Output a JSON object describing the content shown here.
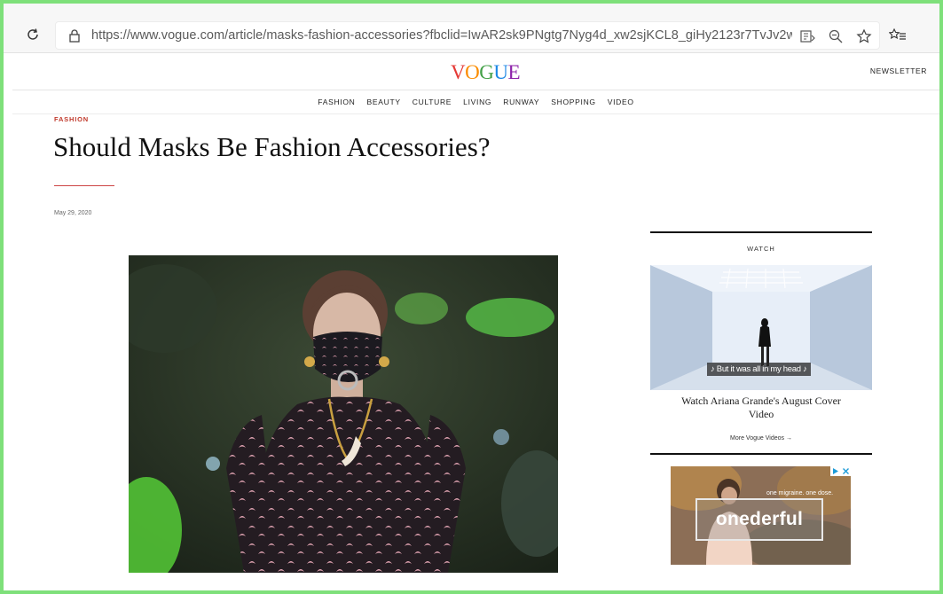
{
  "browser": {
    "url": "https://www.vogue.com/article/masks-fashion-accessories?fbclid=IwAR2sk9PNgtg7Nyg4d_xw2sjKCL8_giHy2123r7TvJv2wl..."
  },
  "site": {
    "logo_letters": [
      "V",
      "O",
      "G",
      "U",
      "E"
    ],
    "newsletter_label": "NEWSLETTER",
    "nav": [
      "FASHION",
      "BEAUTY",
      "CULTURE",
      "LIVING",
      "RUNWAY",
      "SHOPPING",
      "VIDEO"
    ]
  },
  "article": {
    "section": "FASHION",
    "headline": "Should Masks Be Fashion Accessories?",
    "date": "May 29, 2020"
  },
  "sidebar": {
    "watch_label": "WATCH",
    "video_caption": "♪ But it was all in my head ♪",
    "video_title": "Watch Ariana Grande's August Cover Video",
    "more_videos": "More Vogue Videos →"
  },
  "ad": {
    "tagline": "one migraine. one dose.",
    "brand": "onederful"
  },
  "colors": {
    "accent_red": "#c0392b",
    "logo_rainbow": [
      "#e53935",
      "#fb8c00",
      "#43a047",
      "#1e88e5",
      "#8e24aa"
    ]
  }
}
